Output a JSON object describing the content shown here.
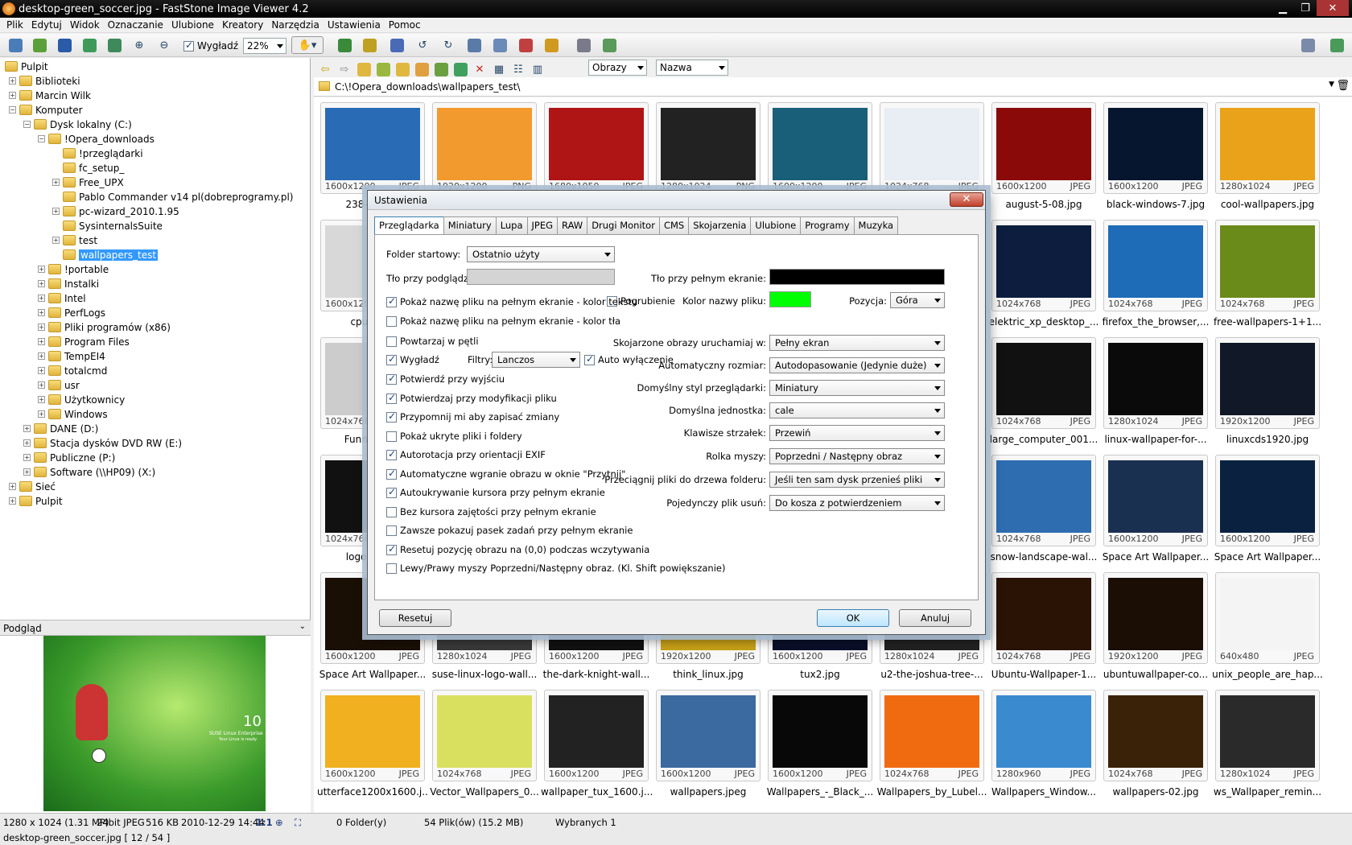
{
  "window": {
    "title": "desktop-green_soccer.jpg - FastStone Image Viewer 4.2"
  },
  "menu": [
    "Plik",
    "Edytuj",
    "Widok",
    "Oznaczanie",
    "Ulubione",
    "Kreatory",
    "Narzędzia",
    "Ustawienia",
    "Pomoc"
  ],
  "toolbar": {
    "smooth_label": "Wygładź",
    "zoom": "22%"
  },
  "nav": {
    "type_filter": "Obrazy",
    "sort": "Nazwa"
  },
  "path": "C:\\!Opera_downloads\\wallpapers_test\\",
  "tree": [
    {
      "label": "Pulpit",
      "level": 0
    },
    {
      "label": "Biblioteki",
      "level": 1
    },
    {
      "label": "Marcin Wilk",
      "level": 1
    },
    {
      "label": "Komputer",
      "level": 1
    },
    {
      "label": "Dysk lokalny (C:)",
      "level": 2
    },
    {
      "label": "!Opera_downloads",
      "level": 3
    },
    {
      "label": "!przeglądarki",
      "level": 4
    },
    {
      "label": "fc_setup_",
      "level": 4
    },
    {
      "label": "Free_UPX",
      "level": 4
    },
    {
      "label": "Pablo Commander v14 pl(dobreprogramy.pl)",
      "level": 4
    },
    {
      "label": "pc-wizard_2010.1.95",
      "level": 4
    },
    {
      "label": "SysinternalsSuite",
      "level": 4
    },
    {
      "label": "test",
      "level": 4
    },
    {
      "label": "wallpapers_test",
      "level": 4
    },
    {
      "label": "!portable",
      "level": 3
    },
    {
      "label": "Instalki",
      "level": 3
    },
    {
      "label": "Intel",
      "level": 3
    },
    {
      "label": "PerfLogs",
      "level": 3
    },
    {
      "label": "Pliki programów (x86)",
      "level": 3
    },
    {
      "label": "Program Files",
      "level": 3
    },
    {
      "label": "TempEI4",
      "level": 3
    },
    {
      "label": "totalcmd",
      "level": 3
    },
    {
      "label": "usr",
      "level": 3
    },
    {
      "label": "Użytkownicy",
      "level": 3
    },
    {
      "label": "Windows",
      "level": 3
    },
    {
      "label": "DANE (D:)",
      "level": 2
    },
    {
      "label": "Stacja dysków DVD RW (E:)",
      "level": 2
    },
    {
      "label": "Publiczne (P:)",
      "level": 2
    },
    {
      "label": "Software (\\\\HP09) (X:)",
      "level": 2
    },
    {
      "label": "Sieć",
      "level": 1
    },
    {
      "label": "Pulpit",
      "level": 1
    }
  ],
  "preview": {
    "header": "Podgląd",
    "badge_number": "10",
    "badge_text": "SUSE Linux Enterprise",
    "badge_sub": "Your Linux is ready"
  },
  "status": {
    "dims": "1280 x 1024 (1.31 MP)",
    "depth": "24bit JPEG",
    "size": "516 KB",
    "date": "2010-12-29 14:44",
    "ratio": "1:1",
    "folders": "0 Folder(y)",
    "files": "54 Plik(ów) (15.2 MB)",
    "selected": "Wybranych 1",
    "current": "desktop-green_soccer.jpg [ 12 / 54 ]"
  },
  "thumbs": [
    {
      "res": "1600x1200",
      "fmt": "JPEG",
      "name": "238-wind...",
      "color": "#2a6bb5"
    },
    {
      "res": "1920x1200",
      "fmt": "PNG",
      "name": "",
      "color": "#f29a2e"
    },
    {
      "res": "1680x1050",
      "fmt": "JPEG",
      "name": "",
      "color": "#b01515"
    },
    {
      "res": "1280x1024",
      "fmt": "PNG",
      "name": "",
      "color": "#222"
    },
    {
      "res": "1600x1200",
      "fmt": "JPEG",
      "name": "",
      "color": "#1a5f7a"
    },
    {
      "res": "1024x768",
      "fmt": "JPEG",
      "name": "",
      "color": "#e8eef3"
    },
    {
      "res": "1600x1200",
      "fmt": "JPEG",
      "name": "august-5-08.jpg",
      "color": "#8a0a0a"
    },
    {
      "res": "1600x1200",
      "fmt": "JPEG",
      "name": "black-windows-7.jpg",
      "color": "#06162e"
    },
    {
      "res": "1280x1024",
      "fmt": "JPEG",
      "name": "cool-wallpapers.jpg",
      "color": "#e9a21a"
    },
    {
      "res": "1600x1200",
      "fmt": "JPEG",
      "name": "cpucub...",
      "color": "#d8d8d8"
    },
    {
      "res": "",
      "fmt": "",
      "name": "",
      "color": "#fff"
    },
    {
      "res": "",
      "fmt": "",
      "name": "",
      "color": "#fff"
    },
    {
      "res": "",
      "fmt": "",
      "name": "",
      "color": "#fff"
    },
    {
      "res": "",
      "fmt": "",
      "name": "",
      "color": "#fff"
    },
    {
      "res": "",
      "fmt": "",
      "name": "",
      "color": "#fff"
    },
    {
      "res": "1024x768",
      "fmt": "JPEG",
      "name": "elektric_xp_desktop_...",
      "color": "#0d1d3d"
    },
    {
      "res": "1024x768",
      "fmt": "JPEG",
      "name": "firefox_the_browser,...",
      "color": "#1e6bb8"
    },
    {
      "res": "1024x768",
      "fmt": "JPEG",
      "name": "free-wallpapers-1+1...",
      "color": "#6a8a1a"
    },
    {
      "res": "1024x768",
      "fmt": "JPEG",
      "name": "Funny_3D...",
      "color": "#ccc"
    },
    {
      "res": "",
      "fmt": "",
      "name": "",
      "color": "#fff"
    },
    {
      "res": "",
      "fmt": "",
      "name": "",
      "color": "#fff"
    },
    {
      "res": "",
      "fmt": "",
      "name": "",
      "color": "#fff"
    },
    {
      "res": "",
      "fmt": "",
      "name": "",
      "color": "#fff"
    },
    {
      "res": "",
      "fmt": "",
      "name": "",
      "color": "#fff"
    },
    {
      "res": "1024x768",
      "fmt": "JPEG",
      "name": "large_computer_001...",
      "color": "#111"
    },
    {
      "res": "1280x1024",
      "fmt": "JPEG",
      "name": "linux-wallpaper-for-...",
      "color": "#0a0a0a"
    },
    {
      "res": "1920x1200",
      "fmt": "JPEG",
      "name": "linuxcds1920.jpg",
      "color": "#111827"
    },
    {
      "res": "1024x768",
      "fmt": "JPEG",
      "name": "logo-spid...",
      "color": "#111"
    },
    {
      "res": "",
      "fmt": "",
      "name": "",
      "color": "#fff"
    },
    {
      "res": "",
      "fmt": "",
      "name": "",
      "color": "#fff"
    },
    {
      "res": "",
      "fmt": "",
      "name": "",
      "color": "#fff"
    },
    {
      "res": "",
      "fmt": "",
      "name": "",
      "color": "#fff"
    },
    {
      "res": "",
      "fmt": "",
      "name": "",
      "color": "#fff"
    },
    {
      "res": "1024x768",
      "fmt": "JPEG",
      "name": "snow-landscape-wal...",
      "color": "#2e6db0"
    },
    {
      "res": "1600x1200",
      "fmt": "JPEG",
      "name": "Space Art Wallpaper...",
      "color": "#1a3050"
    },
    {
      "res": "1600x1200",
      "fmt": "JPEG",
      "name": "Space Art Wallpaper...",
      "color": "#0a2240"
    },
    {
      "res": "1600x1200",
      "fmt": "JPEG",
      "name": "Space Art Wallpaper...",
      "color": "#1a0f05"
    },
    {
      "res": "1280x1024",
      "fmt": "JPEG",
      "name": "suse-linux-logo-wall...",
      "color": "#3a3a3a"
    },
    {
      "res": "1600x1200",
      "fmt": "JPEG",
      "name": "the-dark-knight-wall...",
      "color": "#111"
    },
    {
      "res": "1920x1200",
      "fmt": "JPEG",
      "name": "think_linux.jpg",
      "color": "#c8a218"
    },
    {
      "res": "1600x1200",
      "fmt": "JPEG",
      "name": "tux2.jpg",
      "color": "#0a0f2a"
    },
    {
      "res": "1280x1024",
      "fmt": "JPEG",
      "name": "u2-the-joshua-tree-...",
      "color": "#222"
    },
    {
      "res": "1024x768",
      "fmt": "JPEG",
      "name": "Ubuntu-Wallpaper-1...",
      "color": "#2a1205"
    },
    {
      "res": "1920x1200",
      "fmt": "JPEG",
      "name": "ubuntuwallpaper-co...",
      "color": "#1a0e05"
    },
    {
      "res": "640x480",
      "fmt": "JPEG",
      "name": "unix_people_are_hap...",
      "color": "#f4f4f4"
    },
    {
      "res": "1600x1200",
      "fmt": "JPEG",
      "name": "utterface1200x1600.j...",
      "color": "#f0b020"
    },
    {
      "res": "1024x768",
      "fmt": "JPEG",
      "name": "Vector_Wallpapers_0...",
      "color": "#d9e060"
    },
    {
      "res": "1600x1200",
      "fmt": "JPEG",
      "name": "wallpaper_tux_1600.j...",
      "color": "#222"
    },
    {
      "res": "1600x1200",
      "fmt": "JPEG",
      "name": "wallpapers.jpeg",
      "color": "#3a6aa0"
    },
    {
      "res": "1600x1200",
      "fmt": "JPEG",
      "name": "Wallpapers_-_Black_...",
      "color": "#080808"
    },
    {
      "res": "1024x768",
      "fmt": "JPEG",
      "name": "Wallpapers_by_Lubel...",
      "color": "#f06a10"
    },
    {
      "res": "1280x960",
      "fmt": "JPEG",
      "name": "Wallpapers_Window...",
      "color": "#3a8ad0"
    },
    {
      "res": "1024x768",
      "fmt": "JPEG",
      "name": "wallpapers-02.jpg",
      "color": "#3a2208"
    },
    {
      "res": "1280x1024",
      "fmt": "JPEG",
      "name": "ws_Wallpaper_remin...",
      "color": "#2a2a2a"
    }
  ],
  "dialog": {
    "title": "Ustawienia",
    "tabs": [
      "Przeglądarka",
      "Miniatury",
      "Lupa",
      "JPEG",
      "RAW",
      "Drugi Monitor",
      "CMS",
      "Skojarzenia",
      "Ulubione",
      "Programy",
      "Muzyka"
    ],
    "start_folder_label": "Folder startowy:",
    "start_folder": "Ostatnio użyty",
    "bg_label": "Tło przy podglądzie:",
    "fs_bg_label": "Tło przy pełnym ekranie:",
    "fs_bg_color": "#000000",
    "bg_color": "#d4d4d4",
    "name_color_label": "Kolor nazwy pliku:",
    "name_color": "#00ff00",
    "bold_label": "Pogrubienie",
    "position_label": "Pozycja:",
    "position": "Góra",
    "filter_label": "Filtry:",
    "filter": "Lanczos",
    "auto_off_label": "Auto wyłączenie",
    "checks": [
      {
        "label": "Pokaż nazwę pliku na pełnym ekranie - kolor tekstu",
        "on": true
      },
      {
        "label": "Pokaż nazwę pliku na pełnym ekranie - kolor tła",
        "on": false
      },
      {
        "label": "Powtarzaj w pętli",
        "on": false
      },
      {
        "label": "Wygładź",
        "on": true
      },
      {
        "label": "Potwierdź przy wyjściu",
        "on": true
      },
      {
        "label": "Potwierdzaj przy modyfikacji pliku",
        "on": true
      },
      {
        "label": "Przypomnij mi aby zapisać zmiany",
        "on": true
      },
      {
        "label": "Pokaż ukryte pliki i foldery",
        "on": false
      },
      {
        "label": "Autorotacja przy orientacji EXIF",
        "on": true
      },
      {
        "label": "Automatyczne wgranie obrazu w oknie \"Przytnij\"",
        "on": true
      },
      {
        "label": "Autoukrywanie kursora przy pełnym ekranie",
        "on": true
      },
      {
        "label": "Bez kursora zajętości przy pełnym ekranie",
        "on": false
      },
      {
        "label": "Zawsze pokazuj pasek zadań przy pełnym ekranie",
        "on": false
      },
      {
        "label": "Resetuj pozycję obrazu na (0,0) podczas wczytywania",
        "on": true
      },
      {
        "label": "Lewy/Prawy myszy Poprzedni/Następny obraz. (Kl. Shift powiększanie)",
        "on": false
      }
    ],
    "right_fields": [
      {
        "label": "Skojarzone obrazy uruchamiaj w:",
        "value": "Pełny ekran"
      },
      {
        "label": "Automatyczny rozmiar:",
        "value": "Autodopasowanie (Jedynie duże)"
      },
      {
        "label": "Domyślny styl przeglądarki:",
        "value": "Miniatury"
      },
      {
        "label": "Domyślna jednostka:",
        "value": "cale"
      },
      {
        "label": "Klawisze strzałek:",
        "value": "Przewiń"
      },
      {
        "label": "Rolka myszy:",
        "value": "Poprzedni / Następny obraz"
      },
      {
        "label": "Przeciągnij pliki do drzewa folderu:",
        "value": "Jeśli ten sam dysk przenieś pliki"
      },
      {
        "label": "Pojedynczy plik usuń:",
        "value": "Do kosza z potwierdzeniem"
      }
    ],
    "reset_label": "Resetuj",
    "ok_label": "OK",
    "cancel_label": "Anuluj"
  }
}
